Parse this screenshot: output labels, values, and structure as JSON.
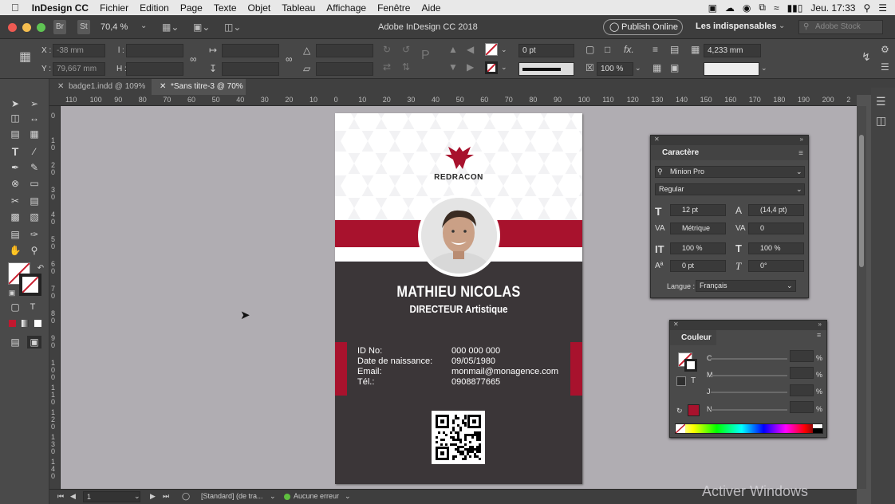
{
  "menubar": {
    "app": "InDesign CC",
    "items": [
      "Fichier",
      "Edition",
      "Page",
      "Texte",
      "Objet",
      "Tableau",
      "Affichage",
      "Fenêtre",
      "Aide"
    ],
    "clock": "Jeu. 17:33"
  },
  "appbar": {
    "br": "Br",
    "st": "St",
    "zoom": "70,4 %",
    "title": "Adobe InDesign CC 2018",
    "publish": "Publish Online",
    "workspace": "Les indispensables",
    "search_placeholder": "Adobe Stock"
  },
  "control": {
    "x_label": "X :",
    "x_value": "-38 mm",
    "y_label": "Y :",
    "y_value": "79,667 mm",
    "w_label": "l :",
    "h_label": "H :",
    "stroke": "0 pt",
    "scale": "100 %",
    "gutter": "4,233 mm"
  },
  "tabs": [
    {
      "label": "badge1.indd @ 109%"
    },
    {
      "label": "*Sans titre-3 @ 70%"
    }
  ],
  "ruler_h": [
    "110",
    "100",
    "90",
    "80",
    "70",
    "60",
    "50",
    "40",
    "30",
    "20",
    "10",
    "0",
    "10",
    "20",
    "30",
    "40",
    "50",
    "60",
    "70",
    "80",
    "90",
    "100",
    "110",
    "120",
    "130",
    "140",
    "150",
    "160",
    "170",
    "180",
    "190",
    "200",
    "2"
  ],
  "ruler_v": [
    "0",
    "1 0",
    "2 0",
    "3 0",
    "4 0",
    "5 0",
    "6 0",
    "7 0",
    "8 0",
    "9 0",
    "1 0 0",
    "1 1 0",
    "1 2 0",
    "1 3 0",
    "1 4 0"
  ],
  "badge": {
    "brand": "REDRACON",
    "name": "MATHIEU NICOLAS",
    "role": "DIRECTEUR Artistique",
    "info_labels": [
      "ID No:",
      "Date de naissance:",
      "Email:",
      "Tél.:"
    ],
    "info_values": [
      "000 000 000",
      "09/05/1980",
      "monmail@monagence.com",
      "0908877665"
    ]
  },
  "caractere": {
    "title": "Caractère",
    "font": "Minion Pro",
    "style": "Regular",
    "size": "12 pt",
    "leading": "(14,4 pt)",
    "kerning": "Métrique",
    "tracking": "0",
    "vscale": "100 %",
    "hscale": "100 %",
    "baseline": "0 pt",
    "skew": "0°",
    "lang_label": "Langue :",
    "lang": "Français"
  },
  "couleur": {
    "title": "Couleur",
    "channels": [
      "C",
      "M",
      "J",
      "N"
    ],
    "pct": "%",
    "tint_label": "T"
  },
  "status": {
    "page": "1",
    "preflight": "[Standard] (de tra...",
    "errors": "Aucune erreur"
  },
  "watermark": "Activer Windows",
  "colors": {
    "accent_red": "#a8122d",
    "badge_dark": "#3b3638"
  }
}
